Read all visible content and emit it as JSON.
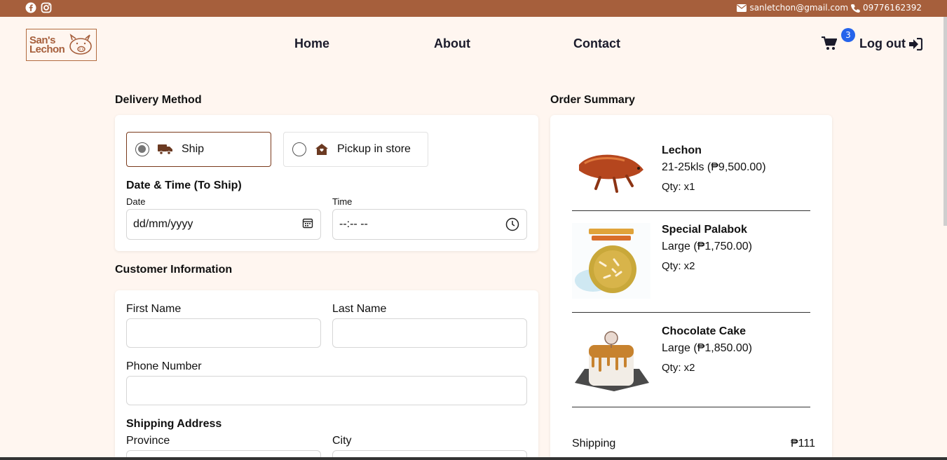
{
  "topbar": {
    "email": "sanletchon@gmail.com",
    "phone": "09776162392",
    "color": "#a65f3c"
  },
  "logo": {
    "line1": "San's",
    "line2": "Lechon"
  },
  "nav": {
    "home": "Home",
    "about": "About",
    "contact": "Contact",
    "cart_count": "3",
    "logout": "Log out"
  },
  "delivery": {
    "title": "Delivery Method",
    "options": [
      {
        "label": "Ship",
        "selected": true,
        "icon": "truck-icon"
      },
      {
        "label": "Pickup in store",
        "selected": false,
        "icon": "store-icon"
      }
    ],
    "datetime_title": "Date & Time (To Ship)",
    "date_label": "Date",
    "date_placeholder": "dd/mm/yyyy",
    "time_label": "Time",
    "time_placeholder": "--:-- --"
  },
  "customer": {
    "title": "Customer Information",
    "first_name_label": "First Name",
    "last_name_label": "Last Name",
    "phone_label": "Phone Number",
    "address_title": "Shipping Address",
    "province_label": "Province",
    "city_label": "City"
  },
  "summary": {
    "title": "Order Summary",
    "items": [
      {
        "name": "Lechon",
        "variant": "21-25kls (₱9,500.00)",
        "qty": "Qty: x1"
      },
      {
        "name": "Special Palabok",
        "variant": "Large (₱1,750.00)",
        "qty": "Qty: x2"
      },
      {
        "name": "Chocolate Cake",
        "variant": "Large (₱1,850.00)",
        "qty": "Qty: x2"
      }
    ],
    "shipping_label": "Shipping",
    "shipping_value": "₱111"
  }
}
